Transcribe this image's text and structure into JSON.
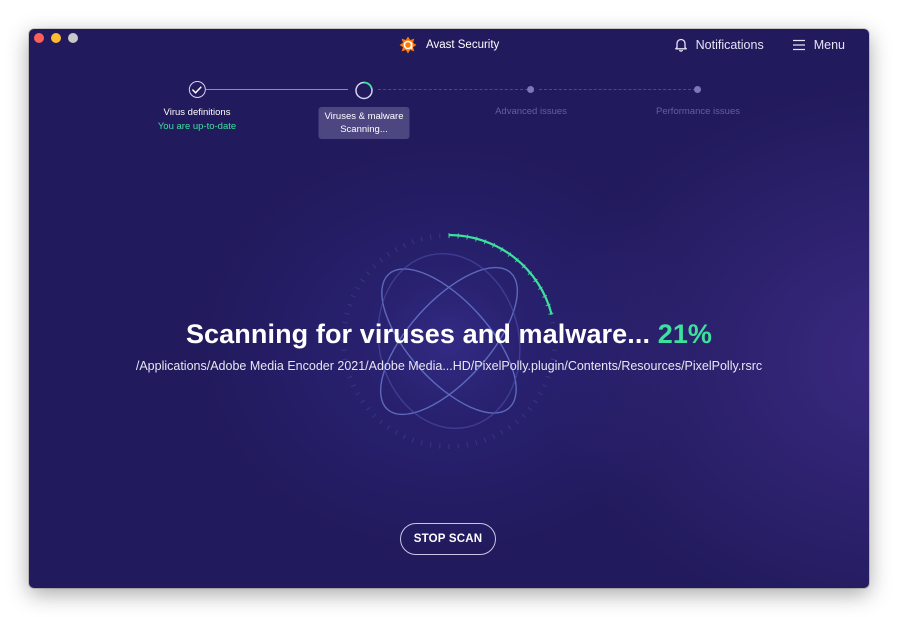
{
  "app": {
    "title": "Avast Security",
    "brand_color": "#ff7800",
    "accent_green": "#3ee09e",
    "background": "#211a5c"
  },
  "header": {
    "notifications_label": "Notifications",
    "menu_label": "Menu"
  },
  "steps": [
    {
      "label": "Virus definitions",
      "status": "You are up-to-date",
      "state": "done",
      "icon": "checkmark-icon"
    },
    {
      "label": "Viruses & malware",
      "status": "Scanning...",
      "state": "active",
      "icon": "spinner-icon"
    },
    {
      "label": "Advanced issues",
      "state": "pending"
    },
    {
      "label": "Performance issues",
      "state": "pending"
    }
  ],
  "scan": {
    "headline": "Scanning for viruses and malware...",
    "percent_text": "21%",
    "progress_fraction": 0.21,
    "current_file": "/Applications/Adobe Media Encoder 2021/Adobe Media...HD/PixelPolly.plugin/Contents/Resources/PixelPolly.rsrc"
  },
  "actions": {
    "stop_label": "STOP SCAN"
  }
}
